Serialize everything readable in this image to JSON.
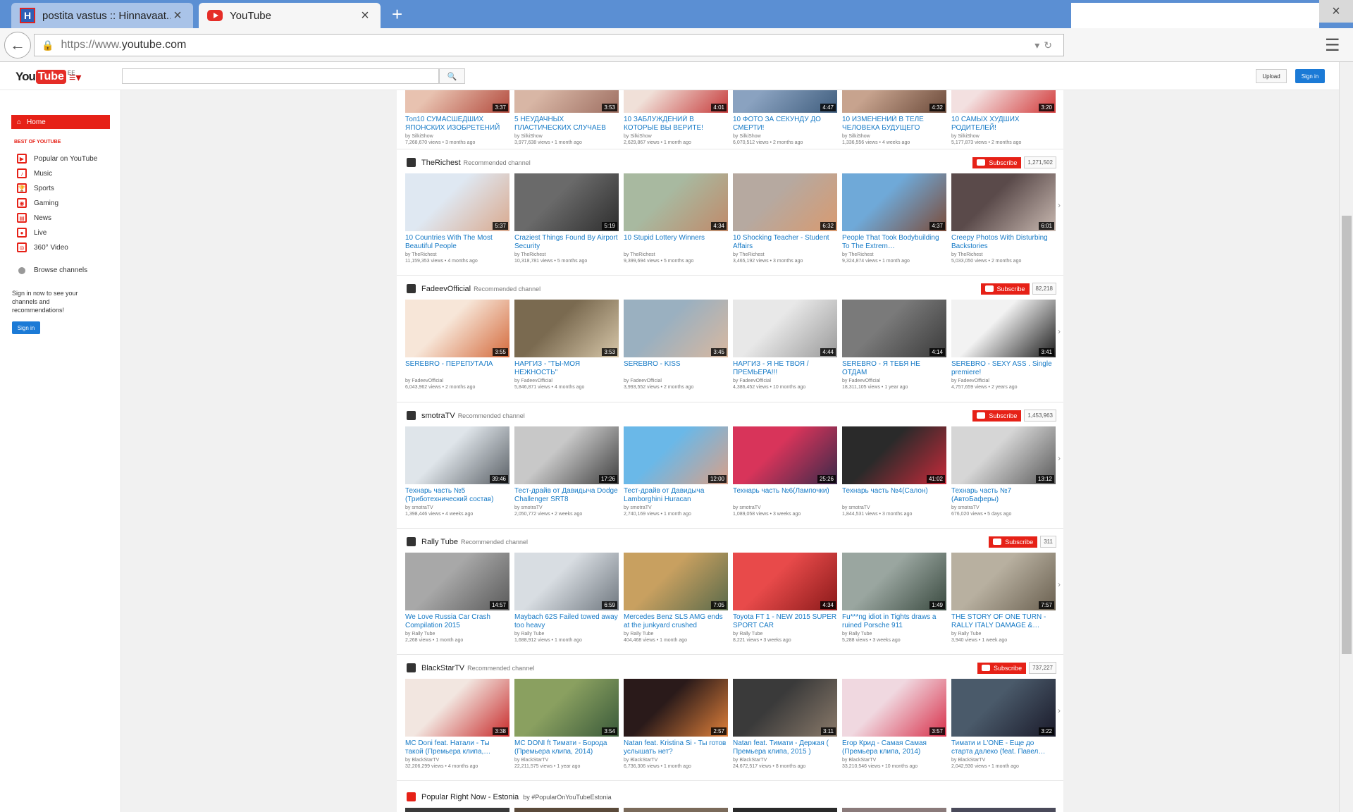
{
  "browser": {
    "tabs": [
      {
        "title": "postita vastus :: Hinnavaat...",
        "favicon": "H"
      },
      {
        "title": "YouTube",
        "favicon": ""
      }
    ],
    "url_prefix": "https://www.",
    "url_domain": "youtube.com",
    "close_glyph": "×",
    "newtab_glyph": "+"
  },
  "yt_header": {
    "logo_you": "You",
    "logo_tube": "Tube",
    "logo_country": "EE",
    "upload_label": "Upload",
    "signin_label": "Sign in"
  },
  "guide": {
    "home_label": "Home",
    "best_label": "BEST OF YOUTUBE",
    "items": [
      {
        "label": "Popular on YouTube",
        "icon": "play-square-icon"
      },
      {
        "label": "Music",
        "icon": "headphones-icon"
      },
      {
        "label": "Sports",
        "icon": "trophy-icon"
      },
      {
        "label": "Gaming",
        "icon": "gamepad-icon"
      },
      {
        "label": "News",
        "icon": "news-icon"
      },
      {
        "label": "Live",
        "icon": "live-icon"
      },
      {
        "label": "360° Video",
        "icon": "360-icon"
      }
    ],
    "browse_label": "Browse channels",
    "signin_text": "Sign in now to see your channels and recommendations!",
    "signin_button": "Sign in"
  },
  "shelves": [
    {
      "channel": "",
      "subs": "",
      "videos": [
        {
          "title": "Топ10 СУМАСШЕДШИХ ЯПОНСКИХ ИЗОБРЕТЕНИЙ",
          "by": "by SilkiShow",
          "views": "7,268,670 views",
          "age": "3 months ago",
          "dur": "3:37",
          "c1": "#e8c2b0",
          "c2": "#b34a3d"
        },
        {
          "title": "5 НЕУДАЧНЫХ ПЛАСТИЧЕСКИХ СЛУЧАЕВ",
          "by": "by SilkiShow",
          "views": "3,977,638 views",
          "age": "1 month ago",
          "dur": "3:53",
          "c1": "#d8b6a5",
          "c2": "#9e6f62"
        },
        {
          "title": "10 ЗАБЛУЖДЕНИЙ В КОТОРЫЕ ВЫ ВЕРИТЕ!",
          "by": "by SilkiShow",
          "views": "2,629,867 views",
          "age": "1 month ago",
          "dur": "4:01",
          "c1": "#f0e0d8",
          "c2": "#c73b3b"
        },
        {
          "title": "10 ФОТО ЗА СЕКУНДУ ДО СМЕРТИ!",
          "by": "by SilkiShow",
          "views": "6,070,512 views",
          "age": "2 months ago",
          "dur": "4:47",
          "c1": "#8aa2c0",
          "c2": "#3f5d7d"
        },
        {
          "title": "10 ИЗМЕНЕНИЙ В ТЕЛЕ ЧЕЛОВЕКА БУДУЩЕГО",
          "by": "by SilkiShow",
          "views": "1,336,556 views",
          "age": "4 weeks ago",
          "dur": "4:32",
          "c1": "#c7a38e",
          "c2": "#6b4a3a"
        },
        {
          "title": "10 САМЫХ ХУДШИХ РОДИТЕЛЕЙ!",
          "by": "by SilkiShow",
          "views": "5,177,873 views",
          "age": "2 months ago",
          "dur": "3:20",
          "c1": "#f3e0e0",
          "c2": "#d23a3a"
        }
      ]
    },
    {
      "channel": "TheRichest",
      "subs": "1,271,502",
      "videos": [
        {
          "title": "10 Countries With The Most Beautiful People",
          "by": "by TheRichest",
          "views": "11,159,353 views",
          "age": "4 months ago",
          "dur": "5:37",
          "c1": "#dfe8f2",
          "c2": "#d9a98e"
        },
        {
          "title": "Craziest Things Found By Airport Security",
          "by": "by TheRichest",
          "views": "10,318,781 views",
          "age": "5 months ago",
          "dur": "5:19",
          "c1": "#6a6a6a",
          "c2": "#2e2e2e"
        },
        {
          "title": "10 Stupid Lottery Winners",
          "by": "by TheRichest",
          "views": "9,399,694 views",
          "age": "5 months ago",
          "dur": "4:34",
          "c1": "#a8b9a0",
          "c2": "#c08a6a"
        },
        {
          "title": "10 Shocking Teacher - Student Affairs",
          "by": "by TheRichest",
          "views": "3,465,192 views",
          "age": "3 months ago",
          "dur": "6:32",
          "c1": "#b6a9a0",
          "c2": "#d89a70"
        },
        {
          "title": "People That Took Bodybuilding To The Extrem…",
          "by": "by TheRichest",
          "views": "9,324,874 views",
          "age": "1 month ago",
          "dur": "4:37",
          "c1": "#6fa9d8",
          "c2": "#7b4c3a"
        },
        {
          "title": "Creepy Photos With Disturbing Backstories",
          "by": "by TheRichest",
          "views": "5,033,050 views",
          "age": "2 months ago",
          "dur": "6:01",
          "c1": "#5a4a4a",
          "c2": "#c8b8b0"
        }
      ]
    },
    {
      "channel": "FadeevOfficial",
      "subs": "82,218",
      "videos": [
        {
          "title": "SEREBRO - ПЕРЕПУТАЛА",
          "by": "by FadeevOfficial",
          "views": "6,043,962 views",
          "age": "2 months ago",
          "dur": "3:55",
          "c1": "#f7e6d8",
          "c2": "#d46a3c"
        },
        {
          "title": "НАРГИЗ - \"ТЫ-МОЯ НЕЖНОСТЬ\"",
          "by": "by FadeevOfficial",
          "views": "5,846,871 views",
          "age": "4 months ago",
          "dur": "3:53",
          "c1": "#7a6a50",
          "c2": "#d6c6a8"
        },
        {
          "title": "SEREBRO - KISS",
          "by": "by FadeevOfficial",
          "views": "3,993,552 views",
          "age": "2 months ago",
          "dur": "3:45",
          "c1": "#9ab0c0",
          "c2": "#d8b8a0"
        },
        {
          "title": "НАРГИЗ - Я НЕ ТВОЯ / ПРЕМЬЕРА!!!",
          "by": "by FadeevOfficial",
          "views": "4,386,452 views",
          "age": "10 months ago",
          "dur": "4:44",
          "c1": "#e8e8e8",
          "c2": "#9a9a9a"
        },
        {
          "title": "SEREBRO - Я ТЕБЯ НЕ ОТДАМ",
          "by": "by FadeevOfficial",
          "views": "18,311,105 views",
          "age": "1 year ago",
          "dur": "4:14",
          "c1": "#7a7a7a",
          "c2": "#3a3a3a"
        },
        {
          "title": "SEREBRO - SEXY ASS . Single premiere!",
          "by": "by FadeevOfficial",
          "views": "4,757,659 views",
          "age": "2 years ago",
          "dur": "3:41",
          "c1": "#f2f2f2",
          "c2": "#1c1c1c"
        }
      ]
    },
    {
      "channel": "smotraTV",
      "subs": "1,453,963",
      "videos": [
        {
          "title": "Технарь часть №5 (Триботехнический состав)",
          "by": "by smotraTV",
          "views": "1,398,446 views",
          "age": "4 weeks ago",
          "dur": "39:46",
          "c1": "#dfe5ea",
          "c2": "#5a6066"
        },
        {
          "title": "Тест-драйв от Давидыча Dodge Challenger SRT8",
          "by": "by smotraTV",
          "views": "2,050,772 views",
          "age": "2 weeks ago",
          "dur": "17:26",
          "c1": "#c8c8c8",
          "c2": "#404040"
        },
        {
          "title": "Тест-драйв от Давидыча Lamborghini Huracan",
          "by": "by smotraTV",
          "views": "2,740,169 views",
          "age": "1 month ago",
          "dur": "12:00",
          "c1": "#6ab8e8",
          "c2": "#d8a088"
        },
        {
          "title": "Технарь часть №6(Лампочки)",
          "by": "by smotraTV",
          "views": "1,089,058 views",
          "age": "3 weeks ago",
          "dur": "25:26",
          "c1": "#d8345a",
          "c2": "#3a2a4a"
        },
        {
          "title": "Технарь часть №4(Салон)",
          "by": "by smotraTV",
          "views": "1,844,531 views",
          "age": "3 months ago",
          "dur": "41:02",
          "c1": "#2a2a2a",
          "c2": "#c82a3a"
        },
        {
          "title": "Технарь часть №7 (АвтоБаферы)",
          "by": "by smotraTV",
          "views": "676,020 views",
          "age": "5 days ago",
          "dur": "13:12",
          "c1": "#d6d6d6",
          "c2": "#5a5a5a"
        }
      ]
    },
    {
      "channel": "Rally Tube",
      "subs": "311",
      "videos": [
        {
          "title": "We Love Russia Car Crash Compilation 2015",
          "by": "by Rally Tube",
          "views": "2,268 views",
          "age": "1 month ago",
          "dur": "14:57",
          "c1": "#a8a8a8",
          "c2": "#5a5a5a"
        },
        {
          "title": "Maybach 62S Failed towed away too heavy",
          "by": "by Rally Tube",
          "views": "1,688,912 views",
          "age": "1 month ago",
          "dur": "6:59",
          "c1": "#d8dde2",
          "c2": "#707880"
        },
        {
          "title": "Mercedes Benz SLS AMG ends at the junkyard crushed",
          "by": "by Rally Tube",
          "views": "404,468 views",
          "age": "1 month ago",
          "dur": "7:05",
          "c1": "#c8a060",
          "c2": "#5a6a4a"
        },
        {
          "title": "Toyota FT 1 - NEW 2015 SUPER SPORT CAR",
          "by": "by Rally Tube",
          "views": "8,221 views",
          "age": "3 weeks ago",
          "dur": "4:34",
          "c1": "#e84a4a",
          "c2": "#8a1a1a"
        },
        {
          "title": "Fu***ng idiot in Tights draws a ruined Porsche 911",
          "by": "by Rally Tube",
          "views": "5,288 views",
          "age": "3 weeks ago",
          "dur": "1:49",
          "c1": "#9aa6a0",
          "c2": "#3a4a40"
        },
        {
          "title": "THE STORY OF ONE TURN - RALLY ITALY DAMAGE &…",
          "by": "by Rally Tube",
          "views": "3,940 views",
          "age": "1 week ago",
          "dur": "7:57",
          "c1": "#b8b0a0",
          "c2": "#6a6050"
        }
      ]
    },
    {
      "channel": "BlackStarTV",
      "subs": "737,227",
      "videos": [
        {
          "title": "MC Doni feat. Натали - Ты такой (Премьера клипа,…",
          "by": "by BlackStarTV",
          "views": "32,206,299 views",
          "age": "4 months ago",
          "dur": "3:38",
          "c1": "#f2e6e0",
          "c2": "#c82a2a"
        },
        {
          "title": "MC DONI ft Тимати - Борода (Премьера клипа, 2014)",
          "by": "by BlackStarTV",
          "views": "22,211,575 views",
          "age": "1 year ago",
          "dur": "3:54",
          "c1": "#8aa060",
          "c2": "#3a5a3a"
        },
        {
          "title": "Natan feat. Kristina Si - Ты готов услышать нет?",
          "by": "by BlackStarTV",
          "views": "6,736,306 views",
          "age": "1 month ago",
          "dur": "2:57",
          "c1": "#2a1a1a",
          "c2": "#e0803a"
        },
        {
          "title": "Natan feat. Тимати - Держая ( Премьера клипа, 2015 )",
          "by": "by BlackStarTV",
          "views": "24,672,517 views",
          "age": "8 months ago",
          "dur": "3:11",
          "c1": "#3a3a3a",
          "c2": "#8a7a6a"
        },
        {
          "title": "Егор Крид - Самая Самая (Премьера клипа, 2014)",
          "by": "by BlackStarTV",
          "views": "33,210,546 views",
          "age": "10 months ago",
          "dur": "3:57",
          "c1": "#f0d8e0",
          "c2": "#d8304a"
        },
        {
          "title": "Тимати и L'ONE - Еще до старта далеко (feat. Павел…",
          "by": "by BlackStarTV",
          "views": "2,042,930 views",
          "age": "1 month ago",
          "dur": "3:22",
          "c1": "#4a5a6a",
          "c2": "#1a1a2a"
        }
      ]
    }
  ],
  "shelf_labels": {
    "recommended": "Recommended channel",
    "subscribe": "Subscribe"
  },
  "popular_now": "Popular Right Now - Estonia",
  "popular_tag": "by #PopularOnYouTubeEstonia"
}
